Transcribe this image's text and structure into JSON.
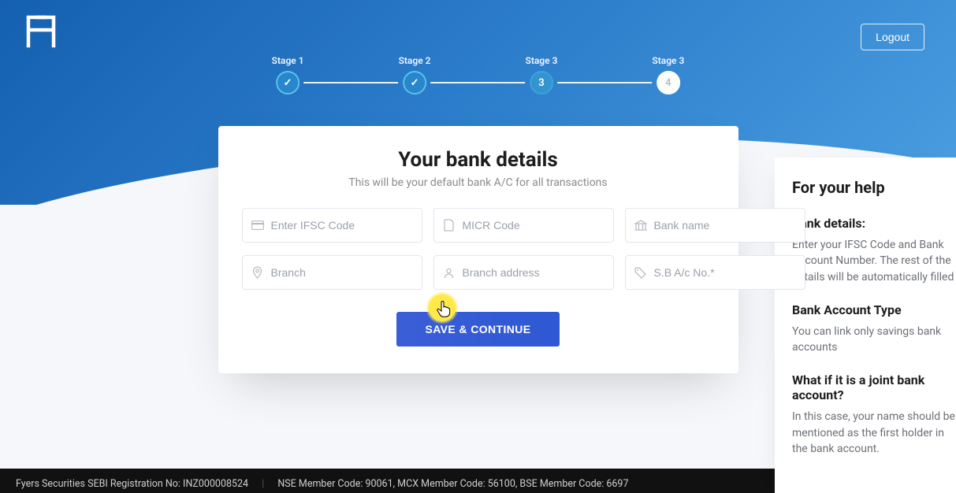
{
  "header": {
    "logout_label": "Logout"
  },
  "stepper": {
    "steps": [
      {
        "label": "Stage 1",
        "content": "✓",
        "state": "done"
      },
      {
        "label": "Stage 2",
        "content": "✓",
        "state": "done"
      },
      {
        "label": "Stage 3",
        "content": "3",
        "state": "current"
      },
      {
        "label": "Stage 3",
        "content": "4",
        "state": "last"
      }
    ]
  },
  "card": {
    "title": "Your bank details",
    "subtitle": "This will be your default bank A/C for all transactions",
    "fields": {
      "ifsc": {
        "placeholder": "Enter IFSC Code",
        "value": ""
      },
      "micr": {
        "placeholder": "MICR Code",
        "value": ""
      },
      "bank": {
        "placeholder": "Bank name",
        "value": ""
      },
      "branch": {
        "placeholder": "Branch",
        "value": ""
      },
      "address": {
        "placeholder": "Branch address",
        "value": ""
      },
      "account": {
        "placeholder": "S.B A/c No.*",
        "value": ""
      }
    },
    "save_label": "SAVE & CONTINUE"
  },
  "help": {
    "title": "For your help",
    "sections": [
      {
        "heading": "Bank details:",
        "body": "Enter your IFSC Code and Bank Account Number. The rest of the details will be automatically filled"
      },
      {
        "heading": "Bank Account Type",
        "body": "You can link only savings bank accounts"
      },
      {
        "heading": "What if it is a joint bank account?",
        "body": "In this case, your name should be mentioned as the first holder in the bank account."
      }
    ]
  },
  "footer": {
    "reg": "Fyers Securities SEBI Registration No: INZ000008524",
    "nse": "NSE Member Code: 90061",
    "mcx": "MCX Member Code: 56100",
    "bse": "BSE Member Code: 6697"
  }
}
